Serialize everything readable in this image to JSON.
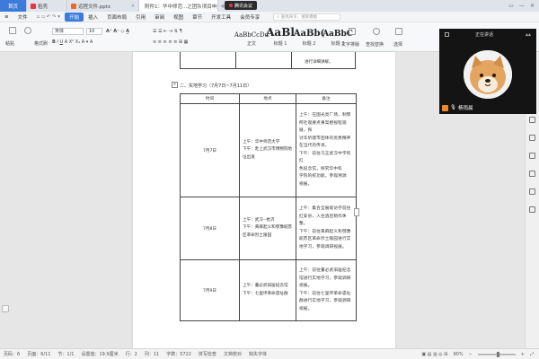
{
  "titlebar": {
    "tabs": [
      {
        "label": "首页",
        "type": "home"
      },
      {
        "label": "稻壳",
        "type": "docer"
      },
      {
        "label": "远程文件.pptx",
        "type": "ppt"
      },
      {
        "label": "附件1：华中师范...之团队项目申报书",
        "type": "doc",
        "active": true
      }
    ],
    "recording_badge": "腾讯会议",
    "new_tab": "+"
  },
  "menu": {
    "items": [
      "文件",
      "开始",
      "插入",
      "页面布局",
      "引用",
      "审阅",
      "视图",
      "章节",
      "开发工具",
      "会员专享"
    ],
    "active": "开始",
    "search_placeholder": "查找命令、搜索模板"
  },
  "ribbon": {
    "font_name": "宋体",
    "font_size": "10",
    "format_painter": "格式刷",
    "paste": "粘贴",
    "styles": [
      {
        "preview": "AaBbCcDd",
        "label": "正文"
      },
      {
        "preview": "AaBl",
        "label": "标题 1"
      },
      {
        "preview": "AaBb(",
        "label": "标题 2"
      },
      {
        "preview": "AaBbC",
        "label": "标题 3"
      }
    ],
    "tools": [
      "文字排版",
      "查找替换",
      "选择"
    ]
  },
  "document": {
    "prev_row_text": "进行详细讲解。",
    "section_heading": "二、实地学习（7月7日~7月11日）",
    "headers": [
      "时间",
      "地点",
      "备注"
    ],
    "rows": [
      {
        "date": "7月7日",
        "content": [
          "上午：华中师范大学",
          "下午：赴上武汉市博物院地",
          "址出发"
        ],
        "note": [
          "上午：在国光亮厂场、制鄂",
          "所社观要点事案相视程观展，探",
          "讨华侨建市团体的优秀精神",
          "在当代的传承。",
          "下午：前往乌王武汉中学的红",
          "色纪念馆，探究华中科",
          "学院的校功能，参观溯源",
          "视展。"
        ]
      },
      {
        "date": "7月8日",
        "content": [
          "上午：武汉--抗济",
          "下午：黄麻起义和鄂豫皖苏",
          "区革命烈士陵园"
        ],
        "note": [
          "上午：集合全展观访学前往",
          "红安县，入住酒店稍作休整。",
          "下午：前往黄麻起义和鄂豫",
          "皖苏区革命烈士陵园进行实",
          "地学习，参观调研视展。"
        ]
      },
      {
        "date": "7月9日",
        "content": [
          "上午：董必武旧居纪念馆",
          "下午：七里坪革命遗址群"
        ],
        "note": [
          "上午：前往董必武旧居纪念",
          "馆进行实地学习，参观调研",
          "视展。",
          "下午：前往七里坪革命遗址",
          "群进行实地学习，参观调研",
          "视展。"
        ]
      }
    ]
  },
  "video": {
    "status": "正在讲话",
    "user_name": "杨雨晨"
  },
  "status": {
    "page": "页码：6",
    "pages": "页面：6/11",
    "section": "节：1/1",
    "setting": "设置值：19.9厘米",
    "row": "行：2",
    "col": "列：11",
    "words": "字数：5722",
    "spell": "拼写检查",
    "doc_check": "文档校对",
    "missing_font": "缺失字体",
    "zoom": "90%"
  },
  "colors": {
    "accent": "#3d7bdb",
    "record": "#e23b3b",
    "video_badge": "#f08a24"
  }
}
